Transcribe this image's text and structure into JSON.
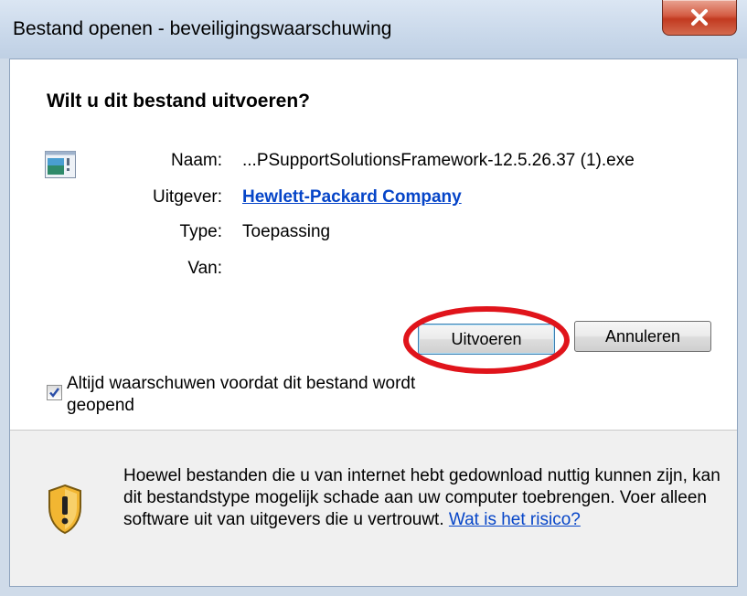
{
  "window": {
    "title": "Bestand openen - beveiligingswaarschuwing",
    "close_label": "X"
  },
  "dialog": {
    "heading": "Wilt u dit bestand uitvoeren?",
    "file_icon": "application-file-icon",
    "info": {
      "name_label": "Naam:",
      "name_value": "...PSupportSolutionsFramework-12.5.26.37 (1).exe",
      "publisher_label": "Uitgever:",
      "publisher_value": "Hewlett-Packard Company",
      "type_label": "Type:",
      "type_value": "Toepassing",
      "from_label": "Van:",
      "from_value": ""
    },
    "buttons": {
      "run_label": "Uitvoeren",
      "cancel_label": "Annuleren"
    },
    "checkbox": {
      "label": "Altijd waarschuwen voordat dit bestand wordt geopend",
      "checked": true
    },
    "warning": {
      "icon": "shield-warning-icon",
      "text": "Hoewel bestanden die u van internet hebt gedownload nuttig kunnen zijn, kan dit bestandstype mogelijk schade aan uw computer toebrengen. Voer alleen software uit van uitgevers die u vertrouwt.",
      "link": "Wat is het risico?"
    }
  },
  "colors": {
    "link": "#0645c8",
    "highlight_circle": "#e0141b",
    "close_button": "#c9452c",
    "titlebar": "#c9d8ea"
  }
}
